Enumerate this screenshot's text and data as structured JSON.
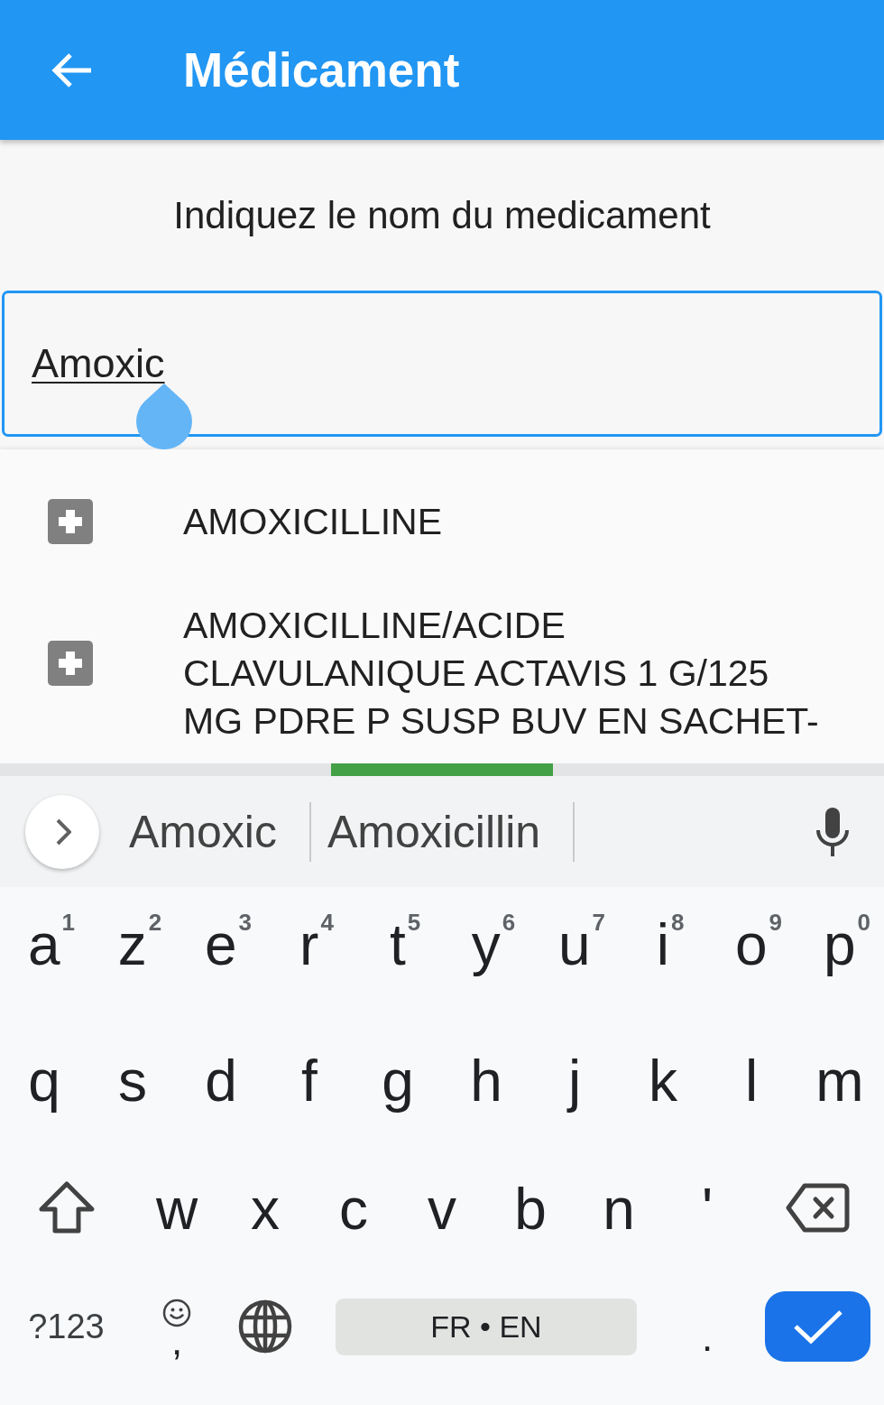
{
  "app_bar": {
    "title": "Médicament"
  },
  "prompt": "Indiquez le nom du medicament",
  "search_field": {
    "value": "Amoxic"
  },
  "results": [
    {
      "label": "AMOXICILLINE"
    },
    {
      "label": "AMOXICILLINE/ACIDE CLAVULANIQUE ACTAVIS 1 G/125 MG PDRE P SUSP BUV EN SACHET-"
    }
  ],
  "keyboard": {
    "suggestions": [
      "Amoxic",
      "Amoxicillin"
    ],
    "rows": [
      {
        "keys": [
          {
            "kind": "letter",
            "label": "a",
            "hint": "1"
          },
          {
            "kind": "letter",
            "label": "z",
            "hint": "2"
          },
          {
            "kind": "letter",
            "label": "e",
            "hint": "3"
          },
          {
            "kind": "letter",
            "label": "r",
            "hint": "4"
          },
          {
            "kind": "letter",
            "label": "t",
            "hint": "5"
          },
          {
            "kind": "letter",
            "label": "y",
            "hint": "6"
          },
          {
            "kind": "letter",
            "label": "u",
            "hint": "7"
          },
          {
            "kind": "letter",
            "label": "i",
            "hint": "8"
          },
          {
            "kind": "letter",
            "label": "o",
            "hint": "9"
          },
          {
            "kind": "letter",
            "label": "p",
            "hint": "0"
          }
        ]
      },
      {
        "keys": [
          {
            "kind": "letter",
            "label": "q"
          },
          {
            "kind": "letter",
            "label": "s"
          },
          {
            "kind": "letter",
            "label": "d"
          },
          {
            "kind": "letter",
            "label": "f"
          },
          {
            "kind": "letter",
            "label": "g"
          },
          {
            "kind": "letter",
            "label": "h"
          },
          {
            "kind": "letter",
            "label": "j"
          },
          {
            "kind": "letter",
            "label": "k"
          },
          {
            "kind": "letter",
            "label": "l"
          },
          {
            "kind": "letter",
            "label": "m"
          }
        ]
      },
      {
        "keys": [
          {
            "kind": "shift"
          },
          {
            "kind": "letter",
            "label": "w"
          },
          {
            "kind": "letter",
            "label": "x"
          },
          {
            "kind": "letter",
            "label": "c"
          },
          {
            "kind": "letter",
            "label": "v"
          },
          {
            "kind": "letter",
            "label": "b"
          },
          {
            "kind": "letter",
            "label": "n"
          },
          {
            "kind": "letter",
            "label": "'"
          },
          {
            "kind": "backspace"
          }
        ]
      },
      {
        "keys": [
          {
            "kind": "symbols",
            "label": "?123"
          },
          {
            "kind": "emoji_comma",
            "label": ","
          },
          {
            "kind": "globe"
          },
          {
            "kind": "space",
            "label": "FR • EN"
          },
          {
            "kind": "period",
            "label": "."
          },
          {
            "kind": "enter"
          }
        ]
      }
    ]
  }
}
